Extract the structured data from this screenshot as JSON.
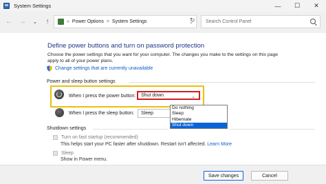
{
  "window": {
    "title": "System Settings"
  },
  "window_controls": {
    "minimize": "—",
    "maximize": "☐",
    "close": "✕"
  },
  "nav": {
    "back": "←",
    "forward": "→",
    "down": "⌄",
    "up": "↑",
    "refresh": "↻"
  },
  "address": {
    "prefix": "«",
    "crumbs": [
      "Power Options",
      "System Settings"
    ],
    "separator": ">"
  },
  "search": {
    "placeholder": "Search Control Panel"
  },
  "page": {
    "title": "Define power buttons and turn on password protection",
    "description": "Choose the power settings that you want for your computer. The changes you make to the settings on this page apply to all of your power plans.",
    "change_link": "Change settings that are currently unavailable"
  },
  "power_section": {
    "label": "Power and sleep button settings",
    "power_button": {
      "label": "When I press the power button:",
      "value": "Shut down"
    },
    "sleep_button": {
      "label": "When I press the sleep button:",
      "value": "Sleep"
    }
  },
  "dropdown": {
    "options": [
      "Do nothing",
      "Sleep",
      "Hibernate",
      "Shut down"
    ],
    "selected_index": 3
  },
  "shutdown_section": {
    "label": "Shutdown settings",
    "fast_startup": {
      "label": "Turn on fast startup (recommended)",
      "desc": "This helps start your PC faster after shutdown. Restart isn't affected.",
      "link": "Learn More"
    },
    "sleep": {
      "label": "Sleep",
      "desc": "Show in Power menu."
    }
  },
  "footer": {
    "save": "Save changes",
    "cancel": "Cancel"
  },
  "colors": {
    "accent": "#0a64d6",
    "title_blue": "#1e3287",
    "highlight_yellow": "#e9c00e",
    "highlight_red": "#d11f1f"
  },
  "icons": {
    "app": "control-panel-icon",
    "address": "power-options-icon",
    "link": "uac-shield-icon",
    "power": "power-button-icon",
    "sleep": "sleep-button-icon",
    "search": "search-icon"
  }
}
